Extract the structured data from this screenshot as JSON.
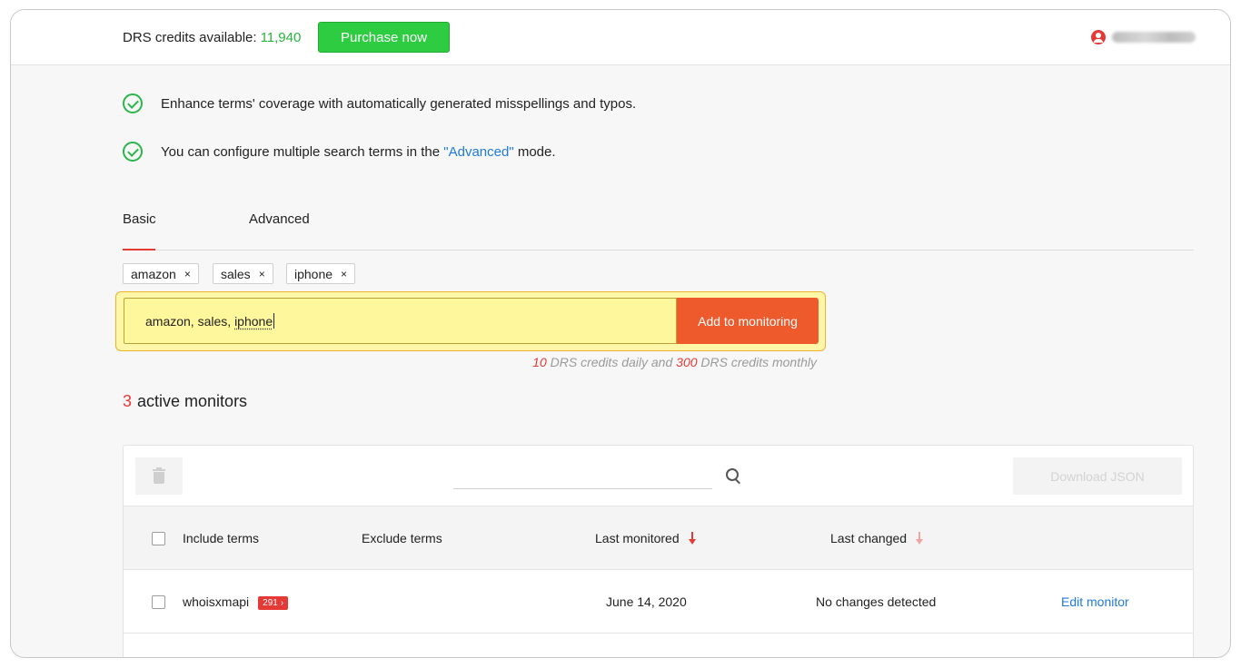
{
  "header": {
    "credits_label": "DRS credits available:",
    "credits_value": "11,940",
    "purchase_label": "Purchase now",
    "user_icon": "user-circle-icon"
  },
  "features": [
    {
      "icon": "check-circle-icon",
      "text": "Enhance terms' coverage with automatically generated misspellings and typos."
    },
    {
      "icon": "check-circle-icon",
      "text_before": "You can configure multiple search terms in the ",
      "link": "\"Advanced\"",
      "text_after": " mode."
    }
  ],
  "tabs": [
    {
      "label": "Basic",
      "active": true
    },
    {
      "label": "Advanced",
      "active": false
    }
  ],
  "chips": [
    {
      "label": "amazon",
      "remove": "×"
    },
    {
      "label": "sales",
      "remove": "×"
    },
    {
      "label": "iphone",
      "remove": "×"
    }
  ],
  "term_input": {
    "value_prefix": "amazon, sales, ",
    "value_last": "iphone",
    "add_button": "Add to monitoring"
  },
  "credits_note": {
    "daily": "10",
    "daily_text": " DRS credits daily and ",
    "monthly": "300",
    "monthly_text": " DRS credits monthly"
  },
  "monitors": {
    "count": "3",
    "label": "active monitors"
  },
  "table": {
    "search_placeholder": "",
    "download_label": "Download JSON",
    "columns": {
      "include": "Include terms",
      "exclude": "Exclude terms",
      "last_monitored": "Last monitored",
      "last_changed": "Last changed"
    },
    "rows": [
      {
        "include": "whoisxmapi",
        "badge": "291",
        "badge_chevron": "›",
        "exclude": "",
        "last_monitored": "June 14, 2020",
        "last_changed": "No changes detected",
        "action": "Edit monitor"
      }
    ]
  },
  "colors": {
    "accent_green": "#2ecc40",
    "accent_red": "#e53935",
    "accent_orange": "#ef5a2c",
    "link_blue": "#1f7ae0",
    "highlight_yellow": "#fff79c"
  }
}
